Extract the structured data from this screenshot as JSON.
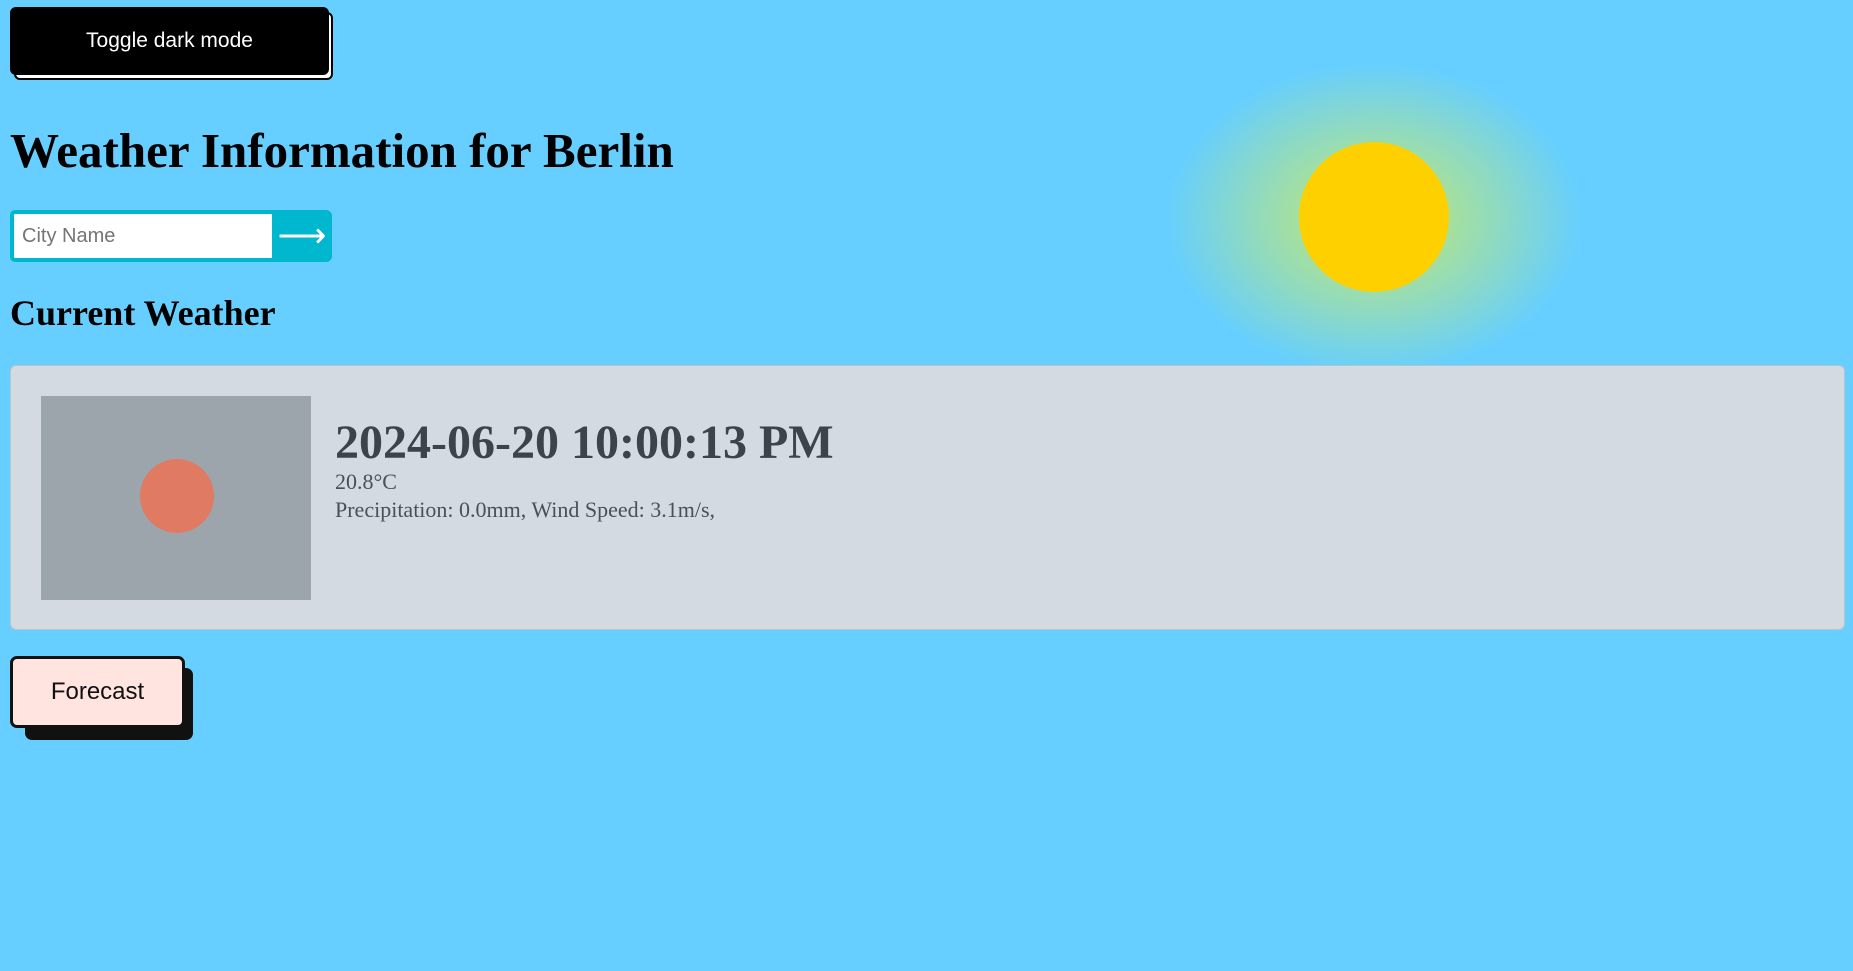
{
  "toggle": {
    "label": "Toggle dark mode"
  },
  "header": {
    "title": "Weather Information for Berlin"
  },
  "search": {
    "placeholder": "City Name",
    "value": "",
    "submit_symbol": "⟶"
  },
  "current": {
    "section_title": "Current Weather",
    "datetime": "2024-06-20 10:00:13 PM",
    "temperature": "20.8°C",
    "details": "Precipitation: 0.0mm, Wind Speed: 3.1m/s,"
  },
  "forecast": {
    "label": "Forecast"
  },
  "colors": {
    "background": "#66cfff",
    "sun": "#ffd000",
    "accent": "#00b7d0",
    "card": "#d3dae2",
    "forecast_button": "#ffe4df"
  },
  "icons": {
    "sun": "sun-icon",
    "submit": "arrow-right-icon",
    "weather": "weather-condition-icon"
  }
}
